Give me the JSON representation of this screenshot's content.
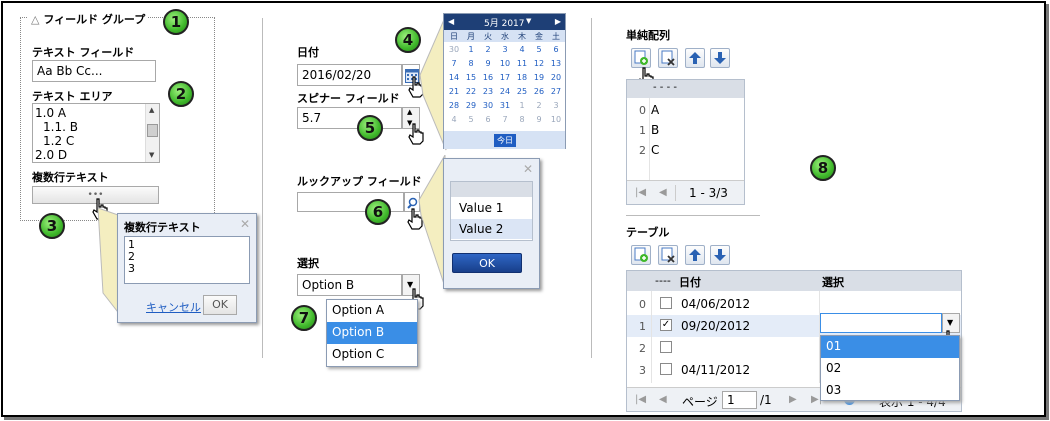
{
  "badges": [
    "1",
    "2",
    "3",
    "4",
    "5",
    "6",
    "7",
    "8"
  ],
  "fieldgroup": {
    "title": "フィールド グループ",
    "text_field_label": "テキスト フィールド",
    "text_field_value": "Aa Bb Cc...",
    "text_area_label": "テキスト エリア",
    "text_area_lines": [
      "1.0 A",
      "1.1. B",
      "1.2 C",
      "2.0 D"
    ],
    "multiline_label": "複数行テキスト"
  },
  "multiline_popup": {
    "title": "複数行テキスト",
    "lines": [
      "1",
      "2",
      "3"
    ],
    "cancel_label": "キャンセル",
    "ok_label": "OK"
  },
  "date": {
    "label": "日付",
    "value": "2016/02/20"
  },
  "calendar": {
    "month_label": "5月 2017",
    "weekdays": [
      "日",
      "月",
      "火",
      "水",
      "木",
      "金",
      "土"
    ],
    "weeks": [
      [
        "30",
        "1",
        "2",
        "3",
        "4",
        "5",
        "6"
      ],
      [
        "7",
        "8",
        "9",
        "10",
        "11",
        "12",
        "13"
      ],
      [
        "14",
        "15",
        "16",
        "17",
        "18",
        "19",
        "20"
      ],
      [
        "21",
        "22",
        "23",
        "24",
        "25",
        "26",
        "27"
      ],
      [
        "28",
        "29",
        "30",
        "31",
        "1",
        "2",
        "3"
      ],
      [
        "4",
        "5",
        "6",
        "7",
        "8",
        "9",
        "10"
      ]
    ],
    "today_label": "今日"
  },
  "spinner": {
    "label": "スピナー フィールド",
    "value": "5.7"
  },
  "lookup": {
    "label": "ルックアップ フィールド",
    "options": [
      "Value 1",
      "Value 2"
    ],
    "ok_label": "OK"
  },
  "select": {
    "label": "選択",
    "value": "Option B",
    "options": [
      "Option A",
      "Option B",
      "Option C"
    ]
  },
  "simple_array": {
    "label": "単純配列",
    "header": "- - - -",
    "rows": [
      {
        "index": "0",
        "value": "A"
      },
      {
        "index": "1",
        "value": "B"
      },
      {
        "index": "2",
        "value": "C"
      }
    ],
    "pager_text": "1 - 3/3"
  },
  "table": {
    "label": "テーブル",
    "col_check": "----",
    "col_date": "日付",
    "col_select": "選択",
    "rows": [
      {
        "index": "0",
        "checked": false,
        "date": "04/06/2012"
      },
      {
        "index": "1",
        "checked": true,
        "date": "09/20/2012"
      },
      {
        "index": "2",
        "checked": false,
        "date": ""
      },
      {
        "index": "3",
        "checked": false,
        "date": "04/11/2012"
      }
    ],
    "dropdown_options": [
      "01",
      "02",
      "03"
    ],
    "pager_page_label": "ページ",
    "pager_page_value": "1",
    "pager_total": "/1",
    "pager_display": "表示 1 - 4/4"
  },
  "colors": {
    "accent": "#1f5dc2",
    "selected": "#3a8ee6",
    "calendar_header": "#1e3f76",
    "badge": "#3fb82b"
  }
}
